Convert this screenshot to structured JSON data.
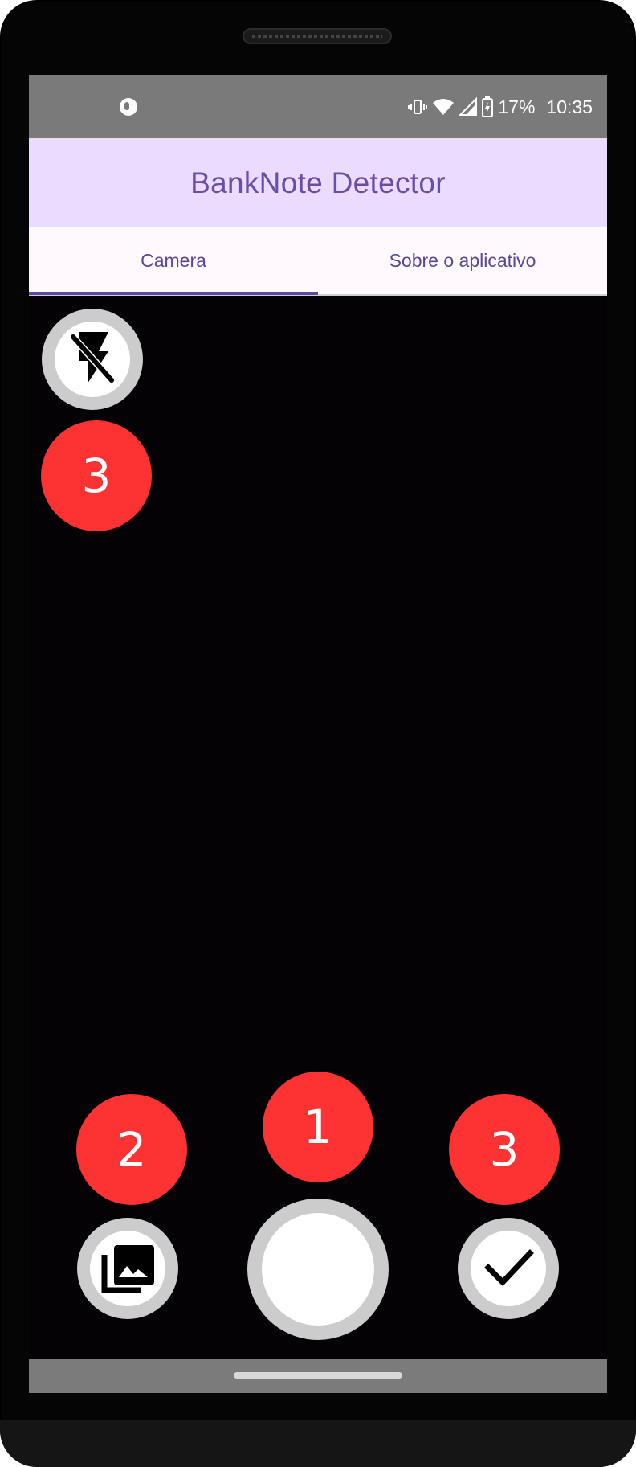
{
  "status_bar": {
    "battery": "17%",
    "time": "10:35",
    "icons": [
      "app-notification-icon",
      "vibrate-icon",
      "wifi-icon",
      "signal-icon",
      "battery-charging-icon"
    ]
  },
  "app_bar": {
    "title": "BankNote Detector"
  },
  "tabs": {
    "camera": "Camera",
    "about": "Sobre o aplicativo",
    "selected": "Camera"
  },
  "controls": {
    "flash_icon": "flash-off-icon",
    "gallery_icon": "photo-library-icon",
    "confirm_icon": "check-icon"
  },
  "badges": {
    "flash": "3",
    "gallery": "2",
    "shutter": "1",
    "confirm": "3"
  },
  "colors": {
    "app_bar_bg": "#eadcff",
    "title_color": "#6a4ea3",
    "tab_indicator": "#5f47a5",
    "badge_red": "#fc3233",
    "button_ring": "#cccccc"
  }
}
